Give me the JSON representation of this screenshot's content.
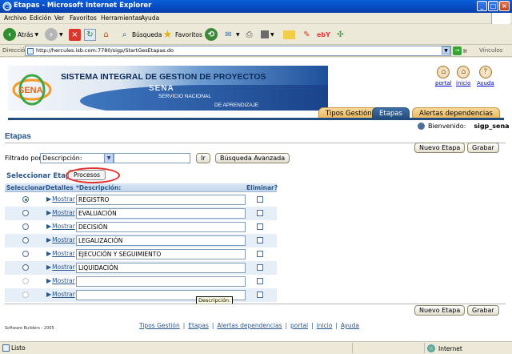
{
  "window": {
    "title": "Etapas - Microsoft Internet Explorer"
  },
  "menu": [
    "Archivo",
    "Edición",
    "Ver",
    "Favoritos",
    "Herramientas",
    "Ayuda"
  ],
  "toolbar": {
    "back": "Atrás",
    "search": "Búsqueda",
    "favorites": "Favoritos"
  },
  "address": {
    "label": "Dirección",
    "url": "http://hercules.isb.com:7780/sigp/StartGesEtapas.do",
    "go": "Ir",
    "links": "Vínculos"
  },
  "banner": {
    "system_name": "SISTEMA INTEGRAL DE GESTION DE PROYECTOS",
    "sena": "SENA",
    "sub1": "SERVICIO NACIONAL",
    "sub2": "DE APRENDIZAJE"
  },
  "top_links": {
    "portal": "portal",
    "inicio": "inicio",
    "ayuda": "Ayuda"
  },
  "tabs": [
    {
      "label": "Tipos Gestión",
      "active": false
    },
    {
      "label": "Etapas",
      "active": true
    },
    {
      "label": "Alertas dependencias",
      "active": false
    }
  ],
  "welcome": {
    "label": "Bienvenido:",
    "user": "sigp_sena"
  },
  "page": {
    "title": "Etapas",
    "new_button": "Nuevo Etapa",
    "save_button": "Grabar",
    "filter_label": "Filtrado por",
    "filter_select": "Descripción:",
    "filter_value": "",
    "go_button": "Ir",
    "advanced_button": "Búsqueda Avanzada",
    "select_label": "Seleccionar Etapa",
    "processes_button": "Procesos"
  },
  "table": {
    "headers": {
      "select": "Seleccionar",
      "details": "Detalles",
      "description": "*Descripción:",
      "delete": "Eliminar?"
    },
    "show_label": "Mostrar",
    "rows": [
      {
        "description": "REGISTRO",
        "selected": true,
        "enabled": true
      },
      {
        "description": "EVALUACIÓN",
        "selected": false,
        "enabled": true
      },
      {
        "description": "DECISIÓN",
        "selected": false,
        "enabled": true
      },
      {
        "description": "LEGALIZACIÓN",
        "selected": false,
        "enabled": true
      },
      {
        "description": "EJECUCIÓN Y SEGUIMIENTO",
        "selected": false,
        "enabled": true
      },
      {
        "description": "LIQUIDACIÓN",
        "selected": false,
        "enabled": true
      },
      {
        "description": "",
        "selected": false,
        "enabled": false
      },
      {
        "description": "",
        "selected": false,
        "enabled": false
      }
    ]
  },
  "tooltip": "Descripción:",
  "footer": {
    "links": [
      "Tipos Gestión",
      "Etapas",
      "Alertas dependencias",
      "portal",
      "inicio",
      "Ayuda"
    ],
    "copyright": "Software Builders - 2005"
  },
  "status": {
    "text": "Listo",
    "zone": "Internet"
  }
}
